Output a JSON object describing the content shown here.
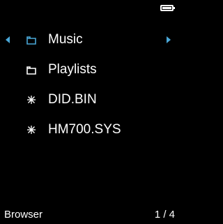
{
  "battery_icon": "battery-full-icon",
  "navigation": {
    "left_icon": "arrow-left-icon",
    "right_icon": "arrow-right-icon",
    "accent_color": "#4aa8d8"
  },
  "browser": {
    "items": [
      {
        "label": "Music",
        "icon": "folder-icon"
      },
      {
        "label": "Playlists",
        "icon": "folder-icon"
      },
      {
        "label": "DID.BIN",
        "icon": "file-icon"
      },
      {
        "label": "HM700.SYS",
        "icon": "file-icon"
      }
    ]
  },
  "status": {
    "mode": "Browser",
    "page": "1 / 4"
  }
}
